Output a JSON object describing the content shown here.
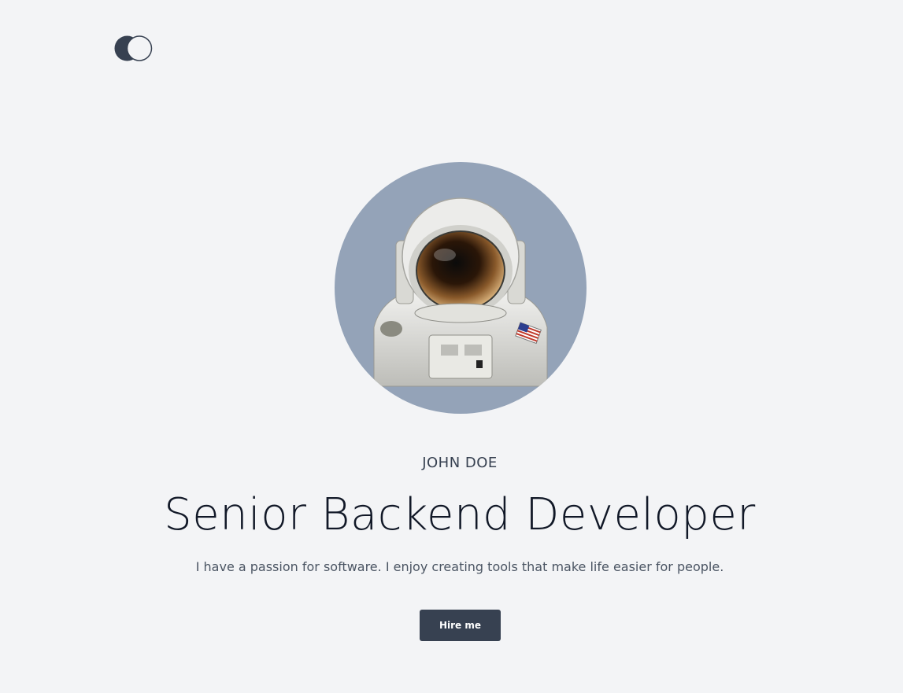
{
  "logo": {
    "icon": "overlapping-circles-logo"
  },
  "profile": {
    "avatar": "astronaut-portrait",
    "avatar_bg": "#94a3b8",
    "name": "JOHN DOE",
    "title": "Senior Backend Developer",
    "bio": "I have a passion for software. I enjoy creating tools that make life easier for people."
  },
  "cta": {
    "label": "Hire me",
    "color": "#374151"
  },
  "theme": {
    "background": "#f3f4f6",
    "text": "#111827"
  }
}
